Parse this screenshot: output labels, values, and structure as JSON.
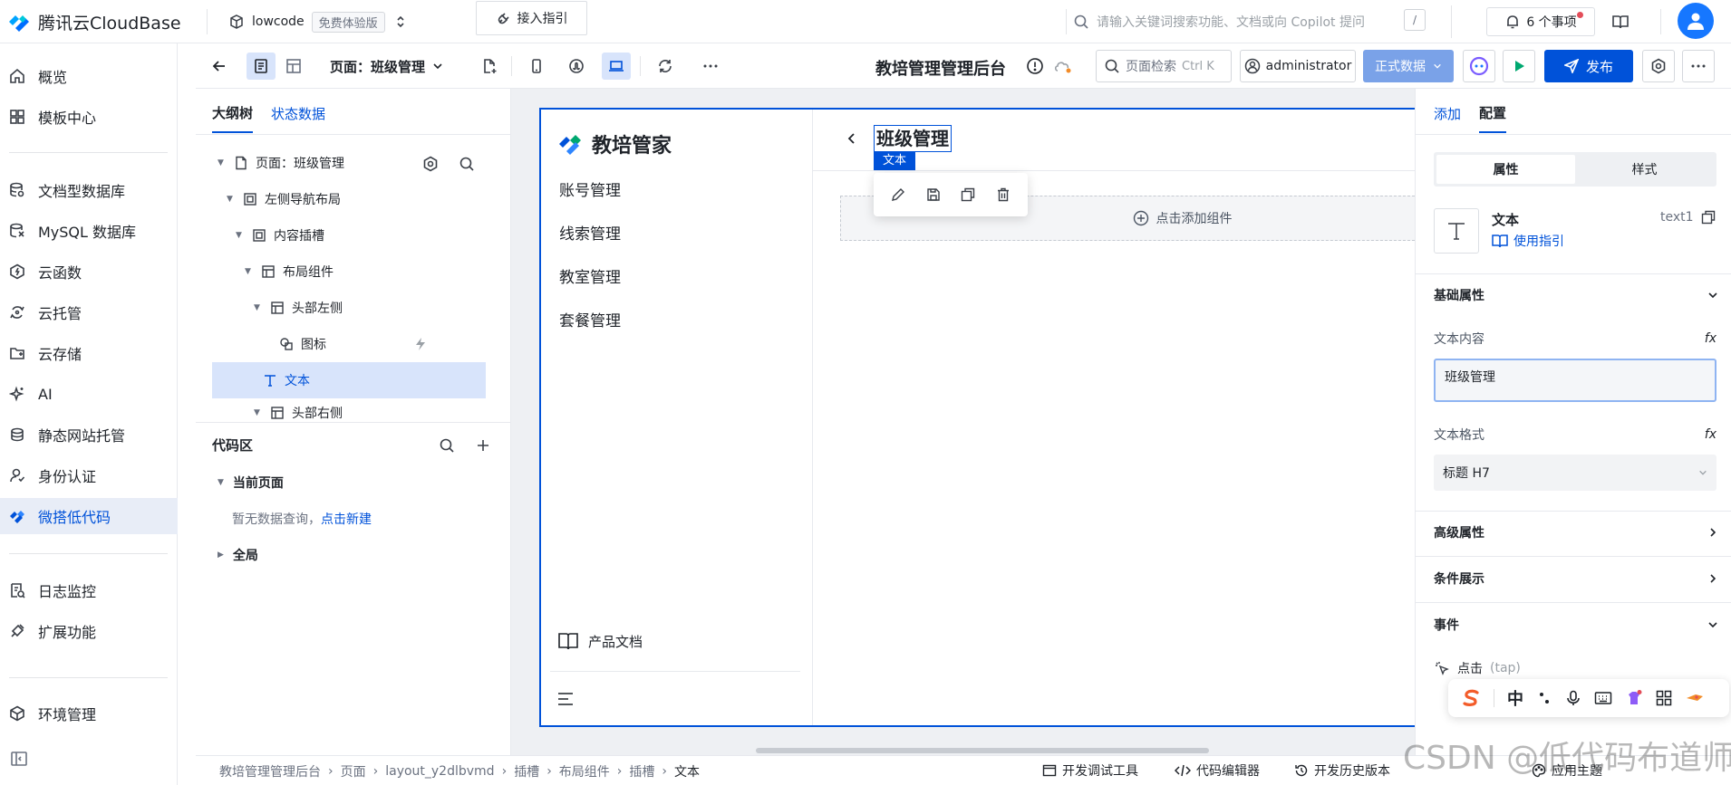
{
  "brand": {
    "name": "腾讯云CloudBase"
  },
  "env": {
    "name": "lowcode",
    "tag": "免费体验版"
  },
  "topbar": {
    "guide": "接入指引",
    "search_placeholder": "请输入关键词搜索功能、文档或向 Copilot 提问",
    "search_shortcut": "/",
    "todo": "6 个事项"
  },
  "leftnav": {
    "items": [
      {
        "label": "概览",
        "icon": "home-icon"
      },
      {
        "label": "模板中心",
        "icon": "grid-icon"
      },
      {
        "label": "文档型数据库",
        "icon": "database-icon"
      },
      {
        "label": "MySQL 数据库",
        "icon": "mysql-icon"
      },
      {
        "label": "云函数",
        "icon": "function-icon"
      },
      {
        "label": "云托管",
        "icon": "cloud-run-icon"
      },
      {
        "label": "云存储",
        "icon": "storage-icon"
      },
      {
        "label": "AI",
        "icon": "sparkle-icon"
      },
      {
        "label": "静态网站托管",
        "icon": "hosting-icon"
      },
      {
        "label": "身份认证",
        "icon": "user-icon"
      },
      {
        "label": "微搭低代码",
        "icon": "lowcode-icon"
      },
      {
        "label": "日志监控",
        "icon": "log-icon"
      },
      {
        "label": "扩展功能",
        "icon": "extension-icon"
      },
      {
        "label": "环境管理",
        "icon": "env-icon"
      }
    ],
    "active": "微搭低代码"
  },
  "toolbar": {
    "page_selector": "页面：班级管理",
    "app_title": "教培管理管理后台",
    "page_search": "页面检索",
    "page_search_shortcut": "Ctrl K",
    "user": "administrator",
    "data_mode": "正式数据",
    "publish": "发布"
  },
  "outline": {
    "tabs": [
      "大纲树",
      "状态数据"
    ],
    "active_tab": "大纲树",
    "tree": [
      {
        "label": "页面：班级管理",
        "level": 0
      },
      {
        "label": "左侧导航布局",
        "level": 1
      },
      {
        "label": "内容插槽",
        "level": 2
      },
      {
        "label": "布局组件",
        "level": 3
      },
      {
        "label": "头部左侧",
        "level": 4
      },
      {
        "label": "图标",
        "level": 5
      },
      {
        "label": "文本",
        "level": 5
      },
      {
        "label": "头部右侧",
        "level": 4
      }
    ],
    "selected": "文本"
  },
  "code": {
    "title": "代码区",
    "current_page": "当前页面",
    "empty_text": "暂无数据查询，",
    "create_link": "点击新建",
    "global": "全局"
  },
  "canvas": {
    "app_name": "教培管家",
    "menu": [
      "账号管理",
      "线索管理",
      "教室管理",
      "套餐管理"
    ],
    "doc_link": "产品文档",
    "page_heading": "班级管理",
    "selected_tag": "文本",
    "add_component": "点击添加组件"
  },
  "rpanel": {
    "tabs": [
      "添加",
      "配置"
    ],
    "active_tab": "配置",
    "seg": [
      "属性",
      "样式"
    ],
    "active_seg": "属性",
    "component_name": "文本",
    "component_id": "text1",
    "usage_guide": "使用指引",
    "basic_props": "基础属性",
    "text_content_label": "文本内容",
    "text_content_value": "班级管理",
    "text_format_label": "文本格式",
    "text_format_value": "标题 H7",
    "advanced": "高级属性",
    "condition": "条件展示",
    "events": "事件",
    "click_event": "点击",
    "click_event_code": "(tap)",
    "fx": "fx"
  },
  "breadcrumb": [
    "教培管理管理后台",
    "页面",
    "layout_y2dlbvmd",
    "插槽",
    "布局组件",
    "插槽",
    "文本"
  ],
  "bottom": {
    "dev_tools": "开发调试工具",
    "code_editor": "代码编辑器",
    "history": "开发历史版本",
    "theme": "应用主题"
  },
  "ime": {
    "zh": "中"
  },
  "watermark": "CSDN @低代码布道师",
  "colors": {
    "primary": "#0052d9",
    "active_bg": "#e8edf7",
    "selected_bg": "#d8e4fb",
    "canvas_bg": "#eef0f3"
  }
}
